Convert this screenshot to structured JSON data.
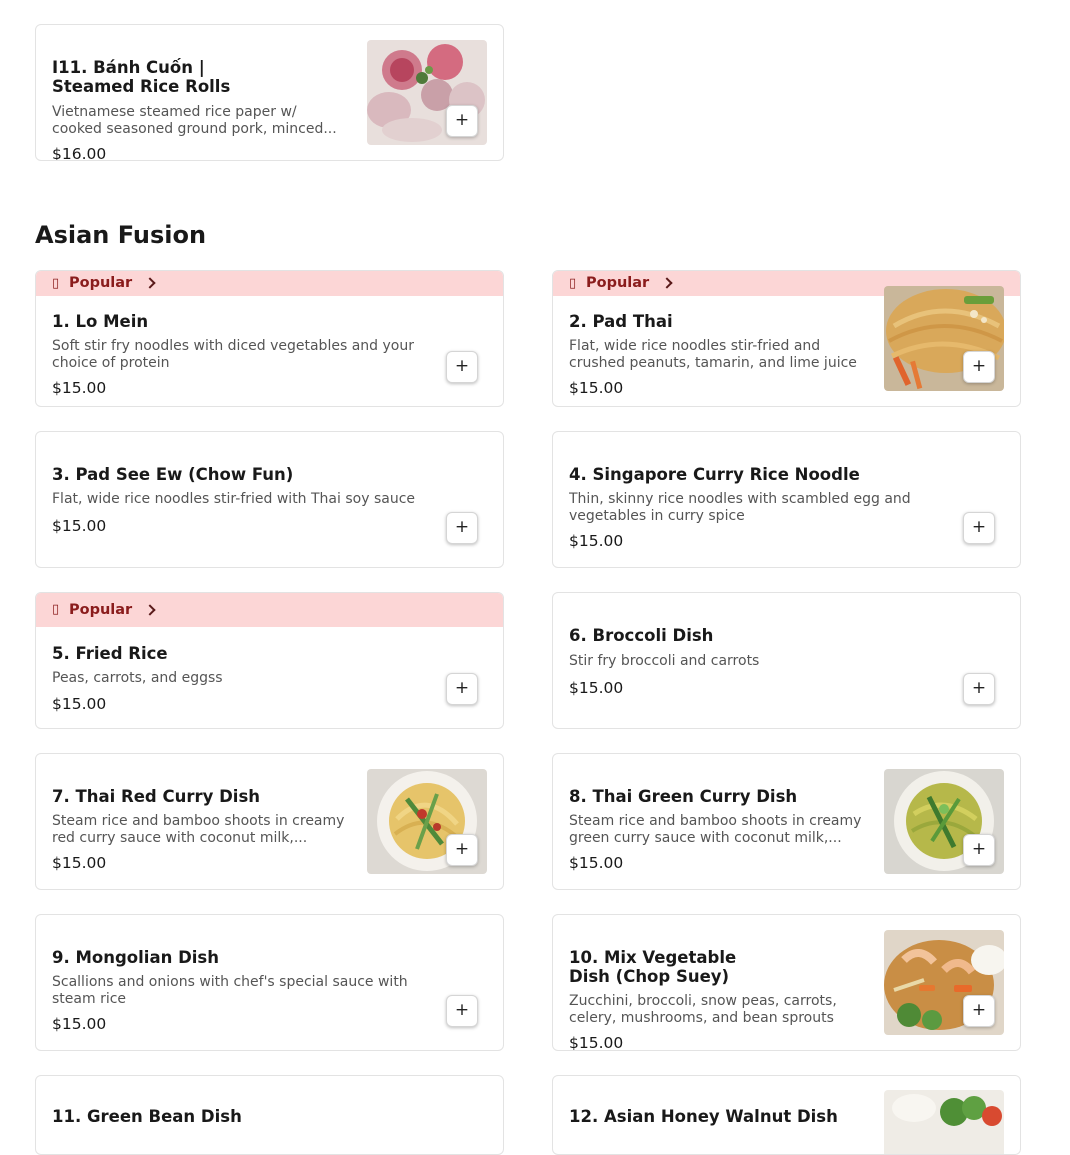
{
  "add_label": "+",
  "popular": {
    "label": "Popular",
    "icon": "fire-icon",
    "glyph": "▯"
  },
  "items": {
    "i11": {
      "name": "I11. Bánh Cuốn | Steamed Rice Rolls",
      "desc": "Vietnamese steamed rice paper w/ cooked seasoned ground pork, minced...",
      "price": "$16.00"
    },
    "d1": {
      "name": "1. Lo Mein",
      "desc": "Soft stir fry noodles with diced vegetables and your choice of protein",
      "price": "$15.00"
    },
    "d2": {
      "name": "2. Pad Thai",
      "desc": "Flat, wide rice noodles stir-fried and crushed peanuts, tamarin, and lime juice",
      "price": "$15.00"
    },
    "d3": {
      "name": "3. Pad See Ew (Chow Fun)",
      "desc": "Flat, wide rice noodles stir-fried with Thai soy sauce",
      "price": "$15.00"
    },
    "d4": {
      "name": "4. Singapore Curry Rice Noodle",
      "desc": "Thin, skinny rice noodles with scambled egg and vegetables in curry spice",
      "price": "$15.00"
    },
    "d5": {
      "name": "5. Fried Rice",
      "desc": "Peas, carrots, and eggss",
      "price": "$15.00"
    },
    "d6": {
      "name": "6. Broccoli Dish",
      "desc": "Stir fry broccoli and carrots",
      "price": "$15.00"
    },
    "d7": {
      "name": "7. Thai Red Curry Dish",
      "desc": "Steam rice and bamboo shoots in creamy red curry sauce with coconut milk,...",
      "price": "$15.00"
    },
    "d8": {
      "name": "8. Thai Green Curry Dish",
      "desc": "Steam rice and bamboo shoots in creamy green curry sauce with coconut milk,...",
      "price": "$15.00"
    },
    "d9": {
      "name": "9. Mongolian Dish",
      "desc": "Scallions and onions with chef's special sauce with steam rice",
      "price": "$15.00"
    },
    "d10": {
      "name": "10. Mix Vegetable Dish (Chop Suey)",
      "desc": "Zucchini, broccoli, snow peas, carrots, celery, mushrooms, and bean sprouts",
      "price": "$15.00"
    },
    "d11": {
      "name": "11. Green Bean Dish"
    },
    "d12": {
      "name": "12. Asian Honey Walnut Dish"
    }
  },
  "section": {
    "title": "Asian Fusion"
  },
  "colors": {
    "popular_bg": "#fcd6d6",
    "popular_text": "#8a1c1c",
    "card_border": "#e3e3e3"
  }
}
